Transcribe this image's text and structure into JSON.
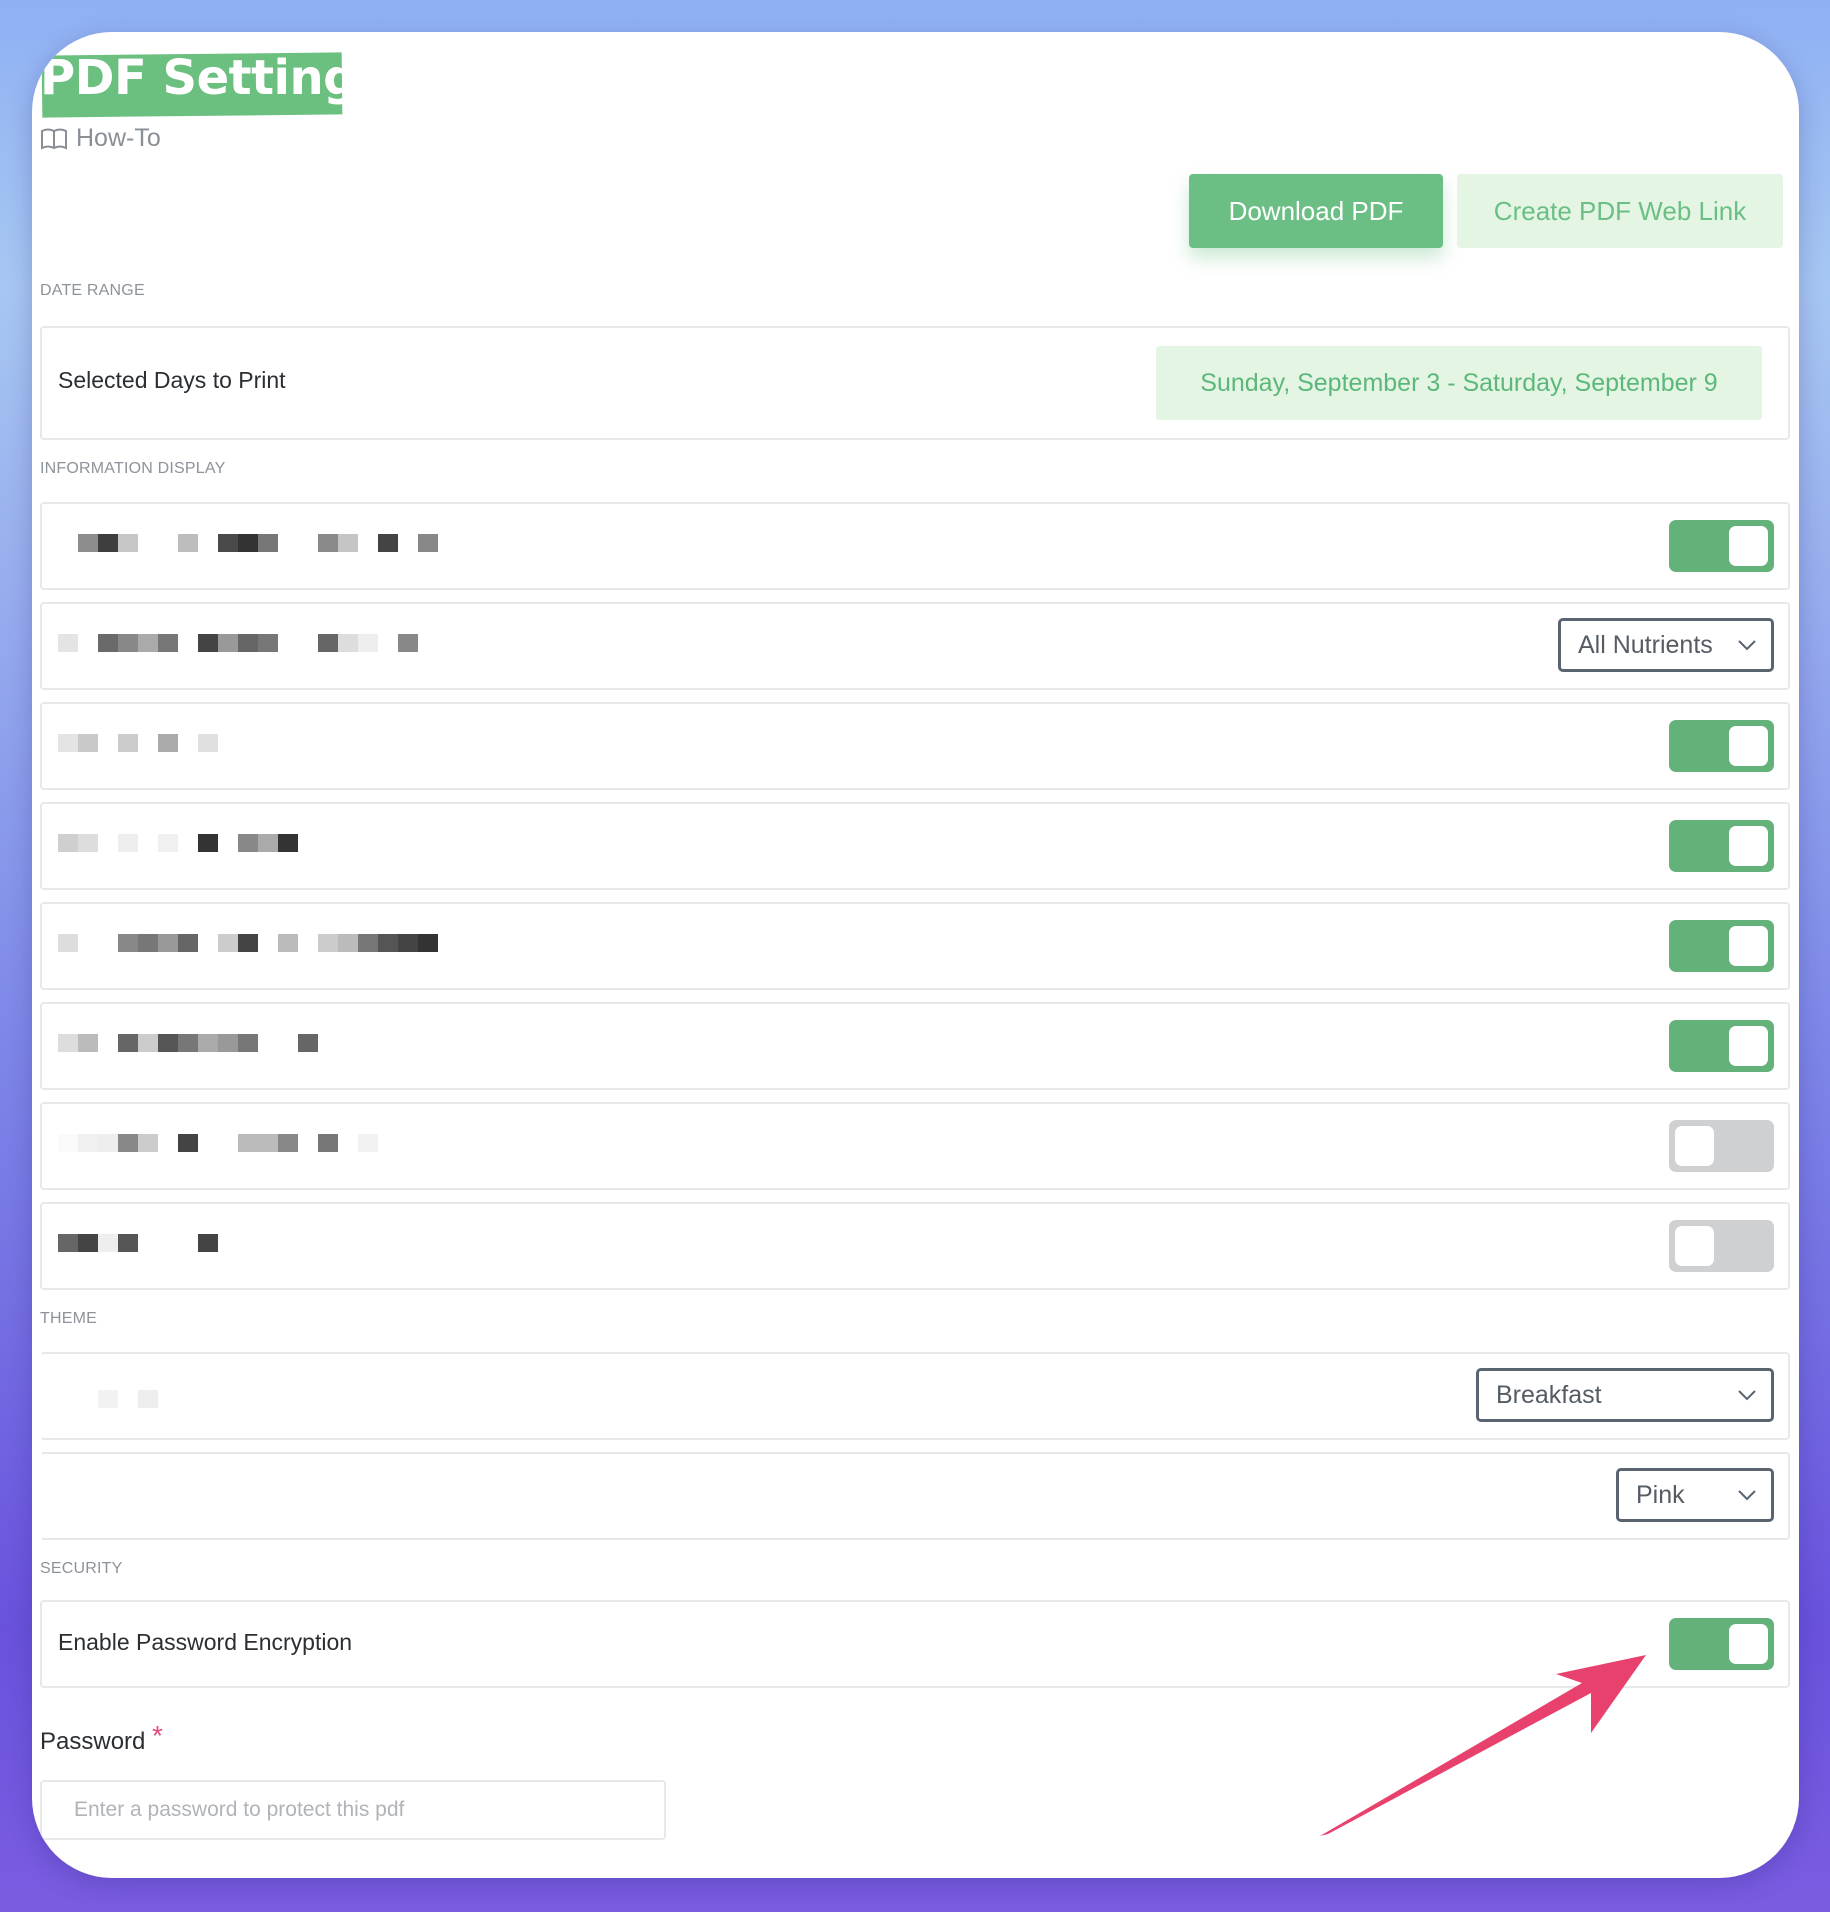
{
  "page": {
    "title": "PDF Settings",
    "howto_label": "How-To"
  },
  "actions": {
    "download_label": "Download PDF",
    "weblink_label": "Create PDF Web Link"
  },
  "sections": {
    "date_range": "DATE RANGE",
    "information_display": "INFORMATION DISPLAY",
    "theme": "THEME",
    "security": "SECURITY"
  },
  "date_range": {
    "label": "Selected Days to Print",
    "value": "Sunday, September 3 - Saturday, September 9"
  },
  "information_display": {
    "rows": [
      {
        "control": "toggle",
        "on": true
      },
      {
        "control": "select",
        "value": "All Nutrients"
      },
      {
        "control": "toggle",
        "on": true
      },
      {
        "control": "toggle",
        "on": true
      },
      {
        "control": "toggle",
        "on": true
      },
      {
        "control": "toggle",
        "on": true
      },
      {
        "control": "toggle",
        "on": false
      },
      {
        "control": "toggle",
        "on": false
      }
    ]
  },
  "theme": {
    "meal_select": "Breakfast",
    "color_select": "Pink"
  },
  "security": {
    "encryption_label": "Enable Password Encryption",
    "encryption_on": true,
    "password_label": "Password",
    "password_required_mark": "*",
    "password_placeholder": "Enter a password to protect this pdf",
    "password_value": ""
  },
  "colors": {
    "accent": "#6bbf84",
    "toggle_on": "#63b27a",
    "toggle_off": "#cfd0d2",
    "annotation_arrow": "#e8416e"
  },
  "icons": [
    "book-icon",
    "chevron-down-icon",
    "annotation-arrow"
  ]
}
